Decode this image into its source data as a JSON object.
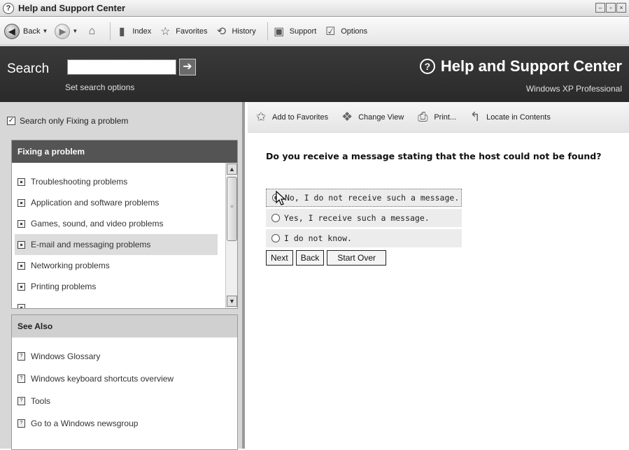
{
  "window": {
    "title": "Help and Support Center"
  },
  "toolbar": {
    "back": "Back",
    "index": "Index",
    "favorites": "Favorites",
    "history": "History",
    "support": "Support",
    "options": "Options"
  },
  "header": {
    "search_label": "Search",
    "search_value": "",
    "search_options": "Set search options",
    "brand_title": "Help and Support Center",
    "brand_subtitle": "Windows XP Professional"
  },
  "left": {
    "scope_label": "Search only Fixing a problem",
    "fixing_title": "Fixing a problem",
    "fixing_items": [
      "Troubleshooting problems",
      "Application and software problems",
      "Games, sound, and video problems",
      "E-mail and messaging problems",
      "Networking problems",
      "Printing problems"
    ],
    "see_also_title": "See Also",
    "see_also_items": [
      "Windows Glossary",
      "Windows keyboard shortcuts overview",
      "Tools",
      "Go to a Windows newsgroup"
    ]
  },
  "content": {
    "actions": {
      "add_favorites": "Add to Favorites",
      "change_view": "Change View",
      "print": "Print...",
      "locate": "Locate in Contents"
    },
    "question": "Do you receive a message stating that the host could not be found?",
    "options": [
      "No, I do not receive such a message.",
      "Yes, I receive such a message.",
      "I do not know."
    ],
    "buttons": {
      "next": "Next",
      "back": "Back",
      "start_over": "Start Over"
    }
  }
}
